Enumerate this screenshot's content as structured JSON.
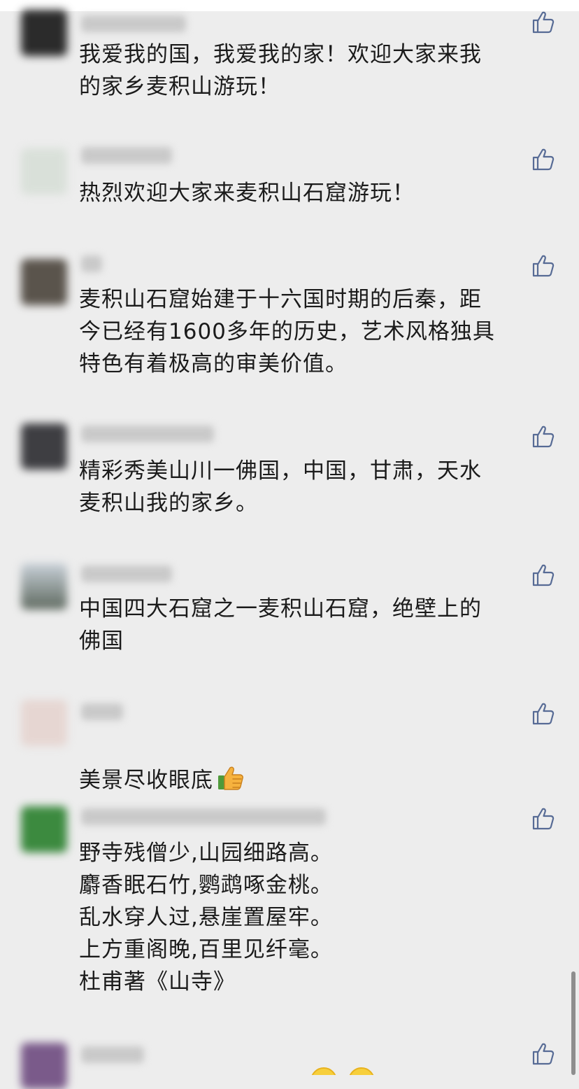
{
  "comments": [
    {
      "text": "我爱我的国，我爱我的家！欢迎大家来我\n的家乡麦积山游玩！"
    },
    {
      "text": "热烈欢迎大家来麦积山石窟游玩！"
    },
    {
      "text": "麦积山石窟始建于十六国时期的后秦，距\n今已经有1600多年的历史，艺术风格独具\n特色有着极高的审美价值。"
    },
    {
      "text": "精彩秀美山川一佛国，中国，甘肃，天水\n麦积山我的家乡。"
    },
    {
      "text": "中国四大石窟之一麦积山石窟，绝壁上的\n佛国"
    },
    {
      "text": "美景尽收眼底",
      "emoji": "thumbs-up-emoji"
    },
    {
      "text": "野寺残僧少,山园细路高。\n麝香眠石竹,鹦鹉啄金桃。\n乱水穿人过,悬崖置屋牢。\n上方重阁晚,百里见纤毫。\n杜甫著《山寺》"
    }
  ],
  "icons": {
    "like": "thumbs-up-outline-icon",
    "emoji": "thumbs-up-emoji"
  },
  "colors": {
    "background": "#ededed",
    "text": "#1b1b1b",
    "like_icon": "#576b95"
  }
}
